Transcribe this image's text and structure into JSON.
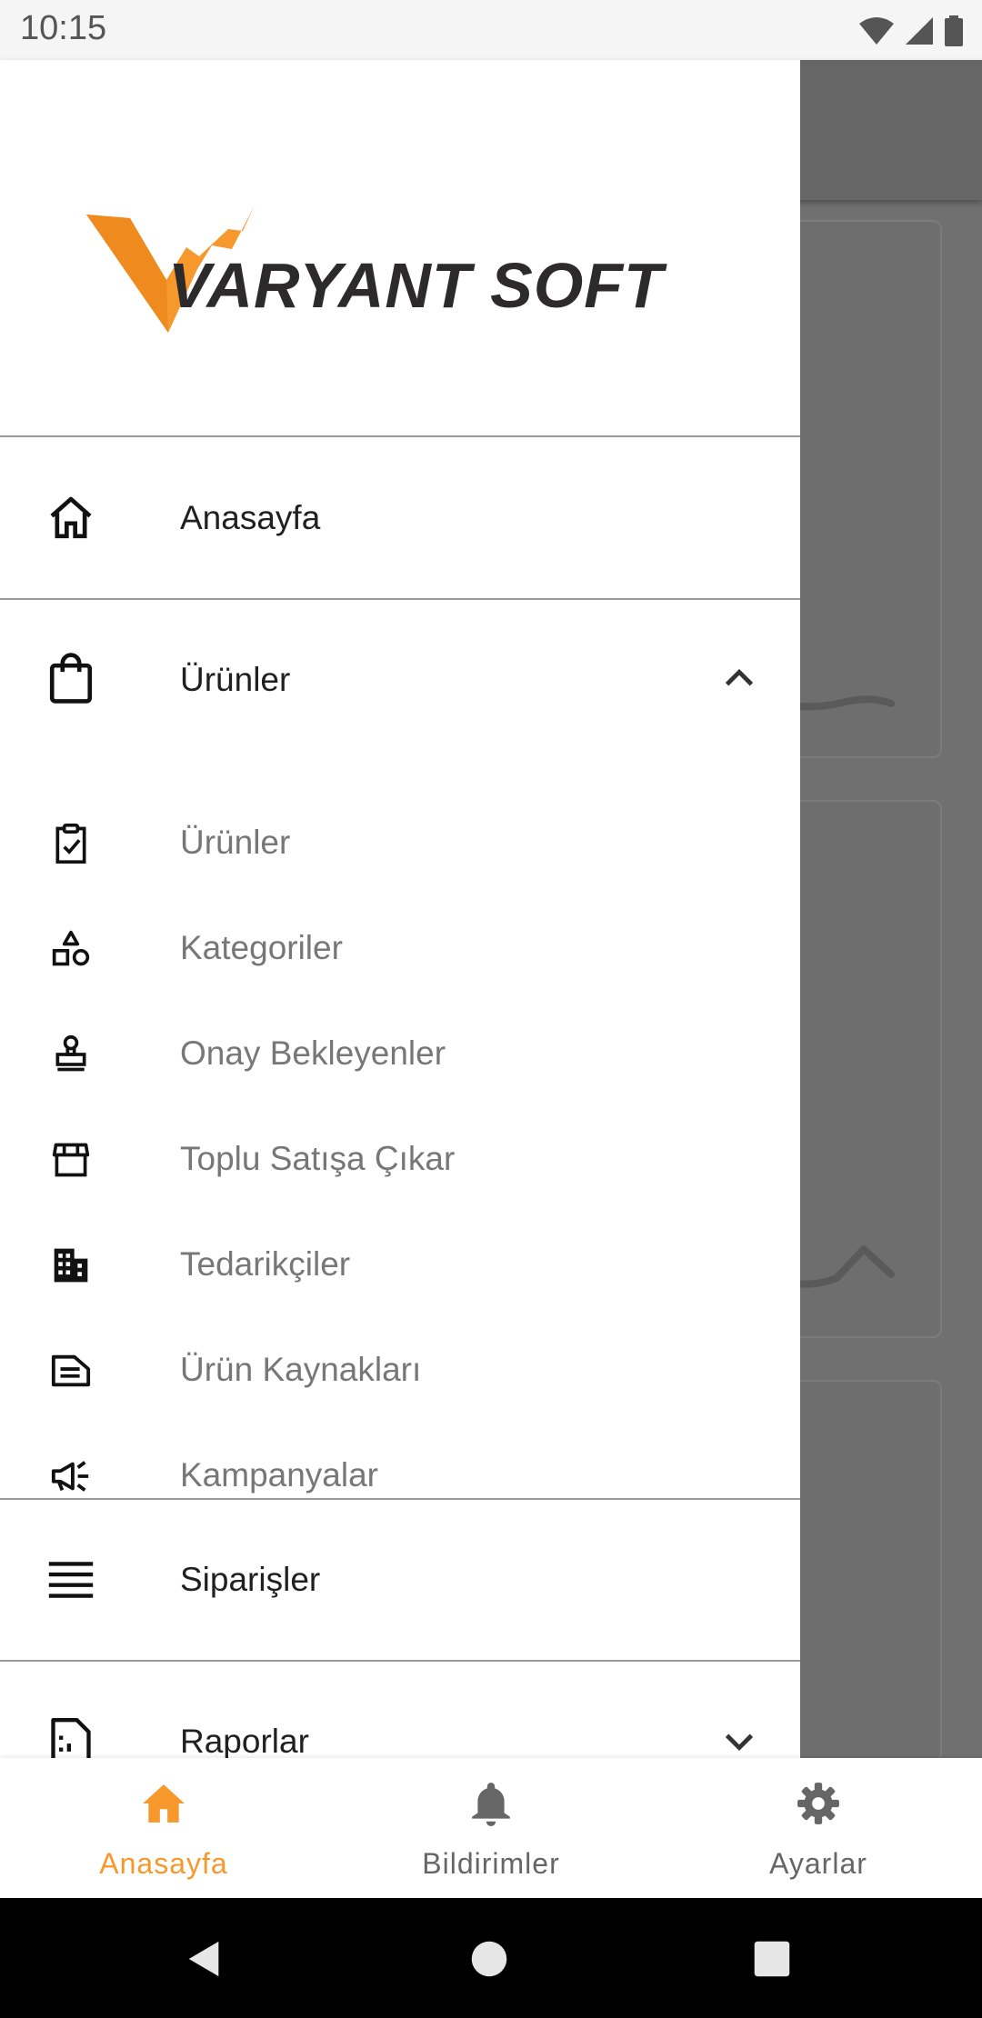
{
  "status_bar": {
    "time": "10:15"
  },
  "brand": {
    "name": "VARYANT SOFT",
    "accent": "#f7982d"
  },
  "drawer": {
    "home": {
      "label": "Anasayfa",
      "icon": "home-icon"
    },
    "products_group": {
      "label": "Ürünler",
      "icon": "shopping-bag-icon",
      "expanded": true,
      "items": [
        {
          "label": "Ürünler",
          "icon": "clipboard-check-icon"
        },
        {
          "label": "Kategoriler",
          "icon": "shapes-icon"
        },
        {
          "label": "Onay Bekleyenler",
          "icon": "stamp-icon"
        },
        {
          "label": "Toplu Satışa Çıkar",
          "icon": "storefront-icon"
        },
        {
          "label": "Tedarikçiler",
          "icon": "building-icon"
        },
        {
          "label": "Ürün Kaynakları",
          "icon": "document-icon"
        },
        {
          "label": "Kampanyalar",
          "icon": "megaphone-icon"
        }
      ]
    },
    "orders": {
      "label": "Siparişler",
      "icon": "list-icon"
    },
    "reports": {
      "label": "Raporlar",
      "icon": "report-icon",
      "expanded": false
    }
  },
  "bottom_nav": {
    "tabs": [
      {
        "label": "Anasayfa",
        "icon": "home-icon",
        "active": true
      },
      {
        "label": "Bildirimler",
        "icon": "bell-icon",
        "active": false
      },
      {
        "label": "Ayarlar",
        "icon": "gear-icon",
        "active": false
      }
    ]
  }
}
